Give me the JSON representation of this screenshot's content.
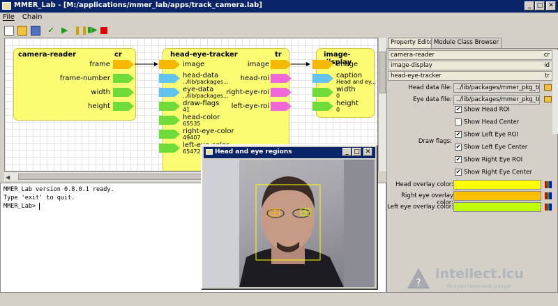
{
  "window": {
    "title": "MMER_Lab - [M:/applications/mmer_lab/apps/track_camera.lab]",
    "buttons": {
      "min": "_",
      "max": "□",
      "close": "✕"
    }
  },
  "menu": [
    "File",
    "Chain"
  ],
  "toolbar": [
    "new-icon",
    "open-icon",
    "save-icon",
    "check-icon",
    "play-icon",
    "pause-icon",
    "step-icon",
    "stop-icon"
  ],
  "modules": {
    "camera": {
      "name": "camera-reader",
      "abbr": "cr",
      "outputs": [
        "frame",
        "frame-number",
        "width",
        "height"
      ]
    },
    "tracker": {
      "name": "head-eye-tracker",
      "abbr": "tr",
      "inputs": [
        {
          "label": "image",
          "sub": ""
        },
        {
          "label": "head-data",
          "sub": "../lib/packages..."
        },
        {
          "label": "eye-data",
          "sub": "../lib/packages..."
        },
        {
          "label": "draw-flags",
          "sub": "41"
        },
        {
          "label": "head-color",
          "sub": "65535"
        },
        {
          "label": "right-eye-color",
          "sub": "49407"
        },
        {
          "label": "left-eye-color",
          "sub": "65472"
        }
      ],
      "outputs": [
        "image",
        "head-roi",
        "right-eye-roi",
        "left-eye-roi"
      ]
    },
    "display": {
      "name": "image-display",
      "abbr": "",
      "inputs": [
        {
          "label": "image",
          "sub": ""
        },
        {
          "label": "caption",
          "sub": "Head and ey..."
        },
        {
          "label": "width",
          "sub": "0"
        },
        {
          "label": "height",
          "sub": "0"
        }
      ]
    }
  },
  "console": [
    "MMER_Lab version 0.8.0.1 ready.",
    "Type 'exit' to quit.",
    "MMER_Lab> "
  ],
  "video": {
    "title": "Head and eye regions"
  },
  "panel": {
    "tabs": [
      "Property Editor",
      "Module Class Browser"
    ],
    "modules": [
      {
        "name": "camera-reader",
        "abbr": "cr"
      },
      {
        "name": "image-display",
        "abbr": "id"
      },
      {
        "name": "head-eye-tracker",
        "abbr": "tr"
      }
    ],
    "head_data": {
      "label": "Head data file:",
      "value": "../lib/packages/mmer_pkg_tracki"
    },
    "eye_data": {
      "label": "Eye data file:",
      "value": "../lib/packages/mmer_pkg_tracki"
    },
    "draw_flags_label": "Draw flags:",
    "flags": [
      {
        "label": "Show Head ROI",
        "checked": true
      },
      {
        "label": "Show Head Center",
        "checked": false
      },
      {
        "label": "Show Left Eye ROI",
        "checked": true
      },
      {
        "label": "Show Left Eye Center",
        "checked": true
      },
      {
        "label": "Show Right Eye ROI",
        "checked": true
      },
      {
        "label": "Show Right Eye Center",
        "checked": true
      }
    ],
    "colors": [
      {
        "label": "Head overlay color:",
        "color": "#ffff00"
      },
      {
        "label": "Right eye overlay color:",
        "color": "#ffc000"
      },
      {
        "label": "Left eye overlay color:",
        "color": "#c0ff00"
      }
    ]
  },
  "watermark": {
    "domain": "intellect.icu",
    "tagline": "Искусственный разум"
  }
}
